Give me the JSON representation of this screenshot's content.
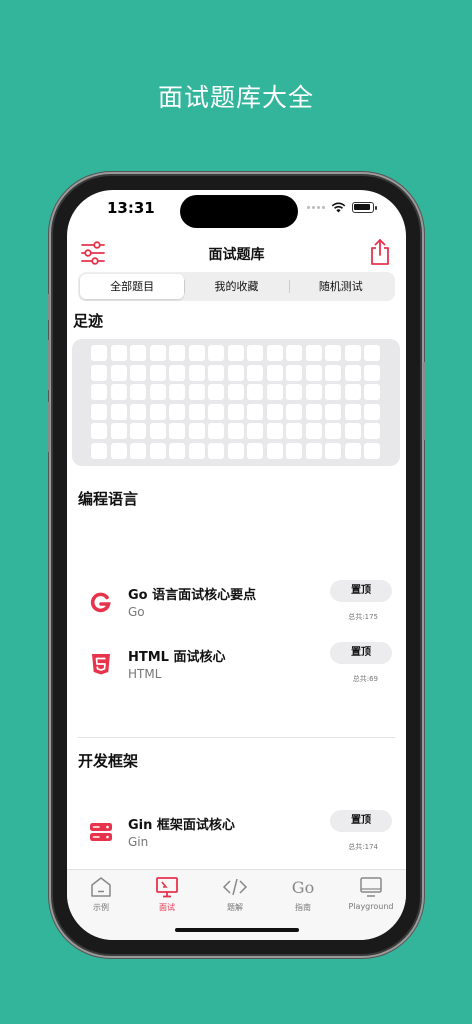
{
  "hero": {
    "title": "面试题库大全"
  },
  "status": {
    "time": "13:31"
  },
  "nav": {
    "title": "面试题库",
    "left_icon": "sliders-icon",
    "right_icon": "share-icon"
  },
  "segments": [
    {
      "label": "全部题目",
      "active": true
    },
    {
      "label": "我的收藏",
      "active": false
    },
    {
      "label": "随机测试",
      "active": false
    }
  ],
  "footprint": {
    "title": "足迹",
    "rows": 6,
    "cols": 15
  },
  "sections": [
    {
      "title": "编程语言",
      "items": [
        {
          "title": "Go 语言面试核心要点",
          "subtitle": "Go",
          "pin_label": "置顶",
          "total": "总共:175",
          "icon": "go-logo-icon"
        },
        {
          "title": "HTML 面试核心",
          "subtitle": "HTML",
          "pin_label": "置顶",
          "total": "总共:69",
          "icon": "html5-logo-icon"
        }
      ]
    },
    {
      "title": "开发框架",
      "items": [
        {
          "title": "Gin 框架面试核心",
          "subtitle": "Gin",
          "pin_label": "置顶",
          "total": "总共:174",
          "icon": "server-stack-icon"
        }
      ]
    }
  ],
  "tabs": [
    {
      "label": "示例",
      "icon": "house-icon",
      "active": false
    },
    {
      "label": "面试",
      "icon": "presentation-icon",
      "active": true
    },
    {
      "label": "题解",
      "icon": "code-brackets-icon",
      "active": false
    },
    {
      "label": "指南",
      "icon": "go-text-icon",
      "icon_text": "Go",
      "active": false
    },
    {
      "label": "Playground",
      "icon": "monitor-icon",
      "active": false
    }
  ],
  "colors": {
    "background": "#33b59c",
    "accent": "#e8334d"
  }
}
